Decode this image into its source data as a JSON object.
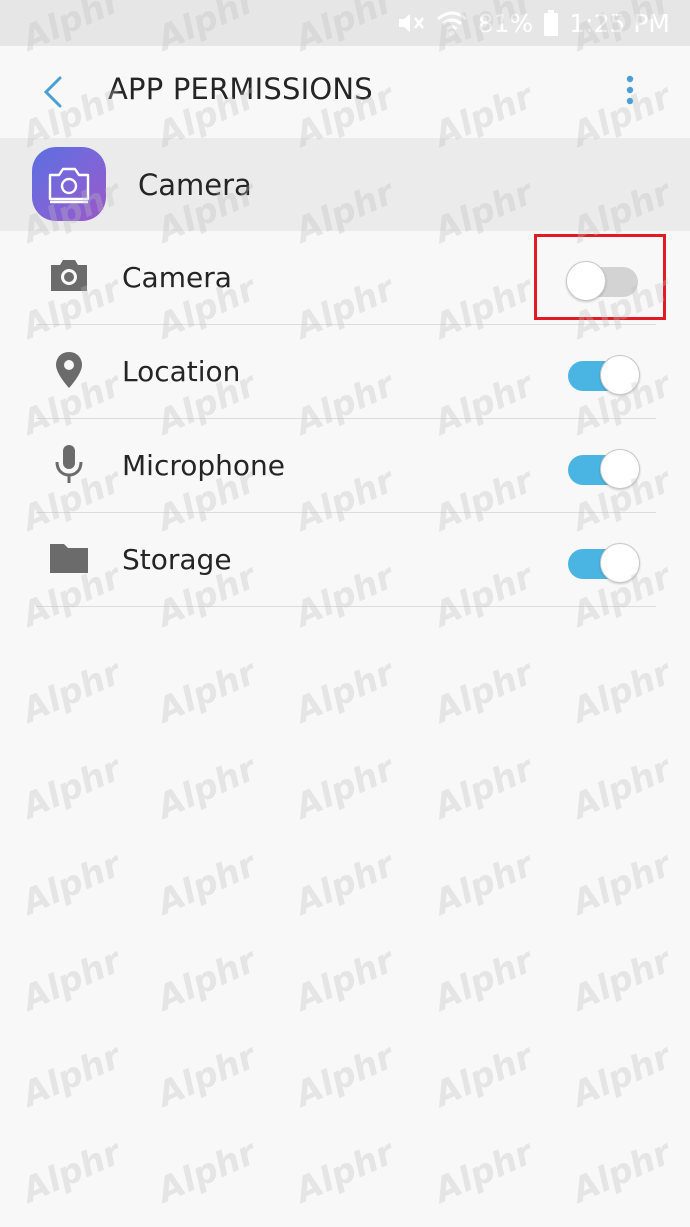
{
  "status_bar": {
    "battery_text": "81%",
    "time": "1:25 PM",
    "icons": [
      "mute-icon",
      "wifi-icon",
      "battery-icon"
    ]
  },
  "app_bar": {
    "title": "APP PERMISSIONS",
    "back_icon": "chevron-left-icon",
    "more_icon": "more-vertical-icon",
    "accent_color": "#4a9fd5"
  },
  "app": {
    "name": "Camera",
    "icon": "camera-app-icon"
  },
  "permissions": [
    {
      "label": "Camera",
      "icon": "camera-icon",
      "enabled": false
    },
    {
      "label": "Location",
      "icon": "location-pin-icon",
      "enabled": true
    },
    {
      "label": "Microphone",
      "icon": "microphone-icon",
      "enabled": true
    },
    {
      "label": "Storage",
      "icon": "folder-icon",
      "enabled": true
    }
  ],
  "colors": {
    "switch_on": "#4ab5e2",
    "switch_off": "#d3d3d3",
    "highlight": "#e01b24"
  },
  "watermark": "Alphr"
}
